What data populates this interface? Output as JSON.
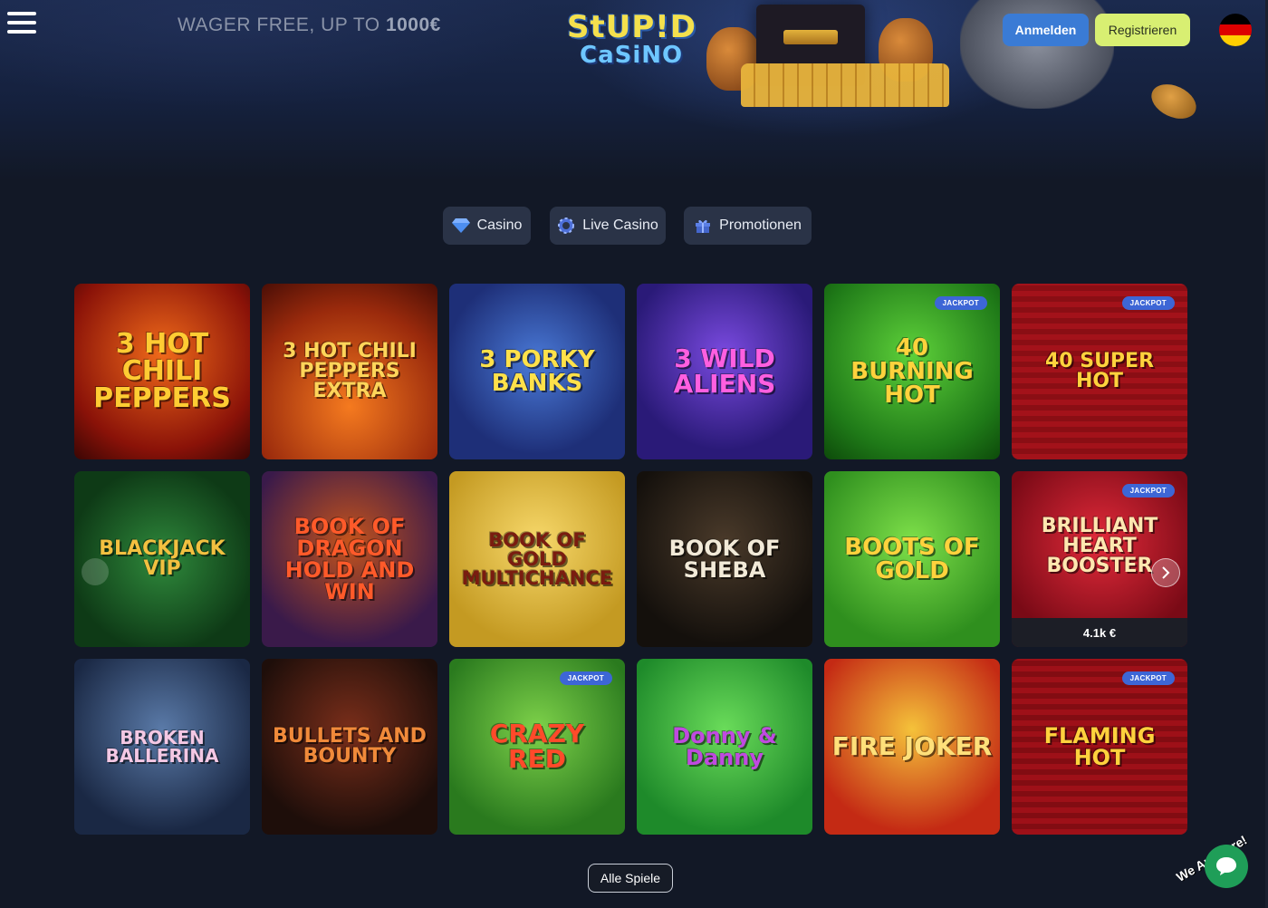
{
  "header": {
    "promo_text_prefix": "WAGER FREE, UP TO",
    "promo_text_amount": "1000€",
    "logo_line1": "StUP!D",
    "logo_line2": "CaSiNO",
    "login_label": "Anmelden",
    "register_label": "Registrieren",
    "language": "de",
    "colors": {
      "login": "#3a7bd5",
      "register": "#d8ef72"
    }
  },
  "tabs": [
    {
      "label": "Casino",
      "icon": "diamond-icon"
    },
    {
      "label": "Live Casino",
      "icon": "casino-chip-icon"
    },
    {
      "label": "Promotionen",
      "icon": "gift-icon"
    }
  ],
  "games": [
    {
      "title": "3 Hot Chili Peppers",
      "badge": "",
      "amount": ""
    },
    {
      "title": "3 Hot Chili Peppers Extra",
      "badge": "",
      "amount": ""
    },
    {
      "title": "3 Porky Banks",
      "badge": "",
      "amount": ""
    },
    {
      "title": "3 Wild Aliens",
      "badge": "",
      "amount": ""
    },
    {
      "title": "40 Burning Hot",
      "badge": "JACKPOT",
      "amount": ""
    },
    {
      "title": "40 Super Hot",
      "badge": "JACKPOT",
      "amount": ""
    },
    {
      "title": "BlackJack VIP",
      "badge": "",
      "amount": ""
    },
    {
      "title": "Book of Dragon Hold and Win",
      "badge": "",
      "amount": ""
    },
    {
      "title": "Book of Gold Multichance",
      "badge": "",
      "amount": ""
    },
    {
      "title": "Book of Sheba",
      "badge": "",
      "amount": ""
    },
    {
      "title": "Boots of Gold",
      "badge": "",
      "amount": ""
    },
    {
      "title": "Brilliant Heart Booster",
      "badge": "JACKPOT",
      "amount": "4.1k €"
    },
    {
      "title": "Broken Ballerina",
      "badge": "",
      "amount": ""
    },
    {
      "title": "Bullets and Bounty",
      "badge": "",
      "amount": ""
    },
    {
      "title": "Crazy Red",
      "badge": "JACKPOT",
      "amount": ""
    },
    {
      "title": "Donny & Danny",
      "badge": "",
      "amount": ""
    },
    {
      "title": "Fire Joker",
      "badge": "",
      "amount": ""
    },
    {
      "title": "Flaming Hot",
      "badge": "JACKPOT",
      "amount": ""
    }
  ],
  "all_games_label": "Alle Spiele",
  "chat": {
    "label": "We Are Here!",
    "icon": "chat-bubble-icon"
  }
}
